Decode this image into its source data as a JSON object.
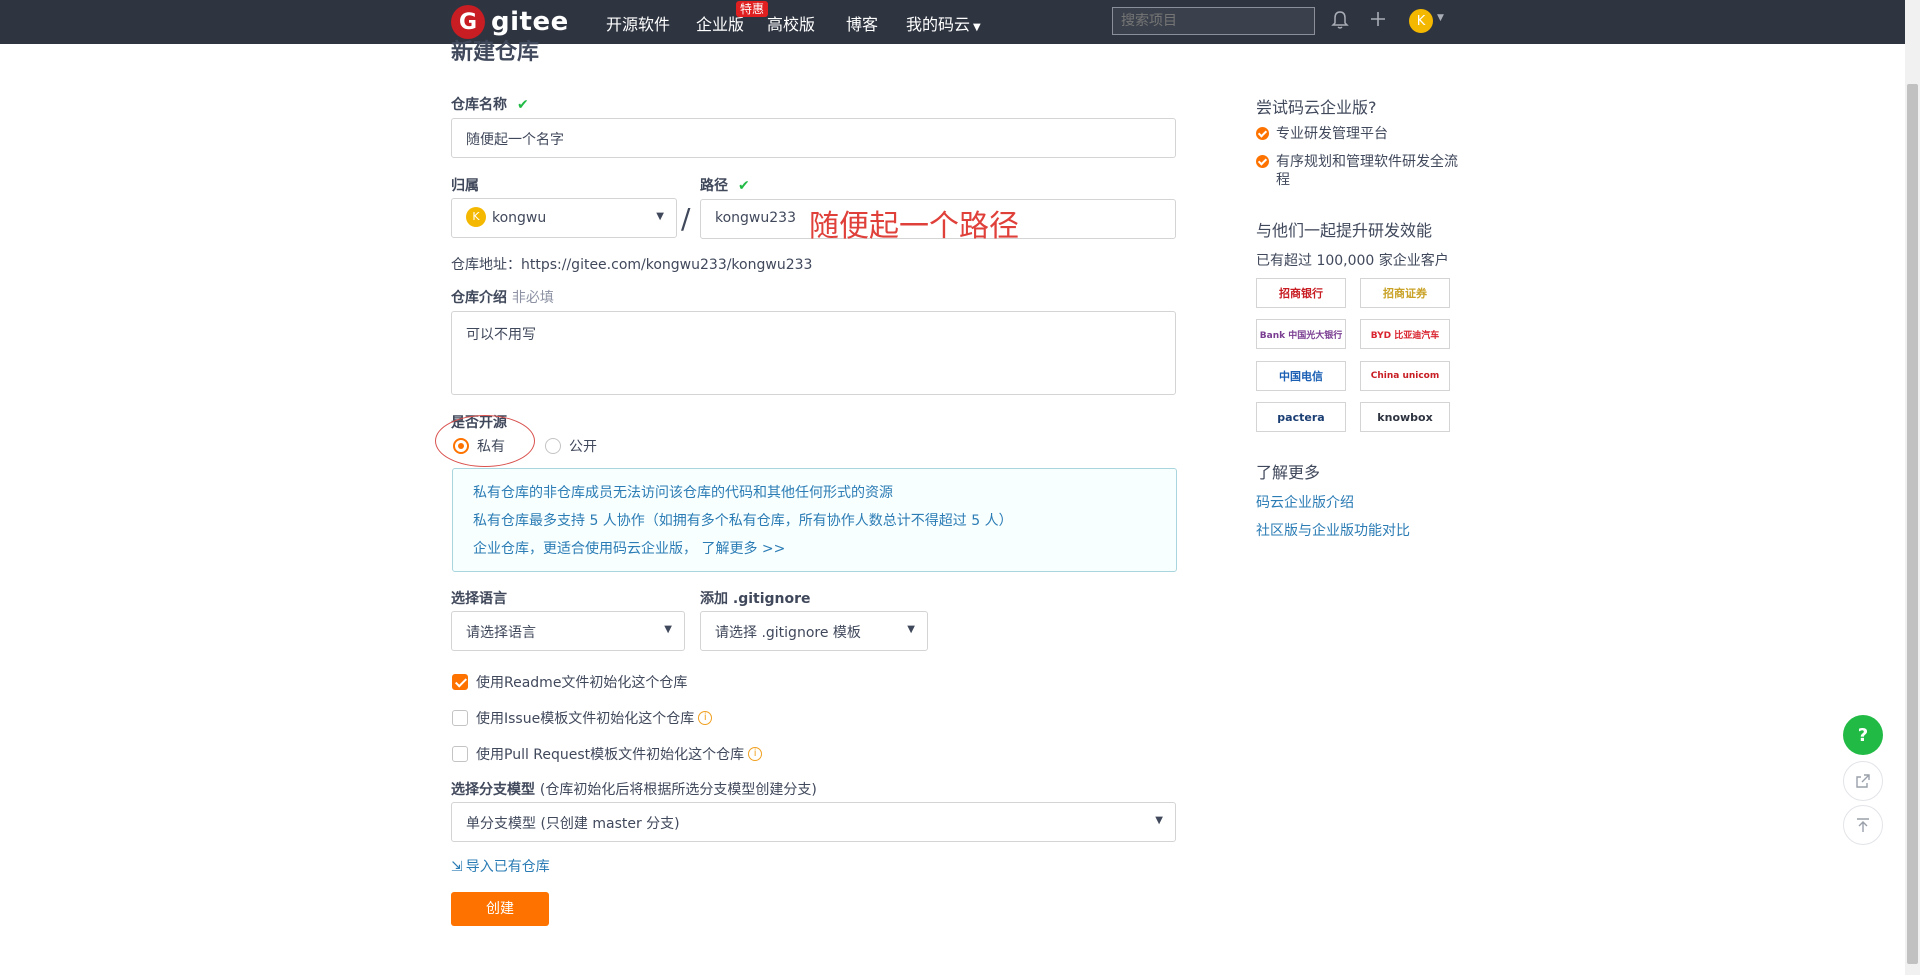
{
  "nav": {
    "logo_text": "gitee",
    "items": [
      "开源软件",
      "企业版",
      "高校版",
      "博客",
      "我的码云"
    ],
    "badge": "特惠",
    "search_placeholder": "搜索项目",
    "avatar_letter": "K",
    "icons": [
      "bell-icon",
      "plus-icon",
      "user-avatar"
    ]
  },
  "form": {
    "title": "新建仓库",
    "repo_name_label": "仓库名称",
    "repo_name_value": "随便起一个名字",
    "owner_label": "归属",
    "owner_value": "kongwu",
    "owner_avatar": "K",
    "path_label": "路径",
    "path_value": "kongwu233",
    "path_annotation": "随便起一个路径",
    "slash": "/",
    "repo_url": "仓库地址：https://gitee.com/kongwu233/kongwu233",
    "desc_label": "仓库介绍",
    "desc_optional": "非必填",
    "desc_value": "可以不用写",
    "open_source_label": "是否开源",
    "radio_private": "私有",
    "radio_public": "公开",
    "info_lines": [
      "私有仓库的非仓库成员无法访问该仓库的代码和其他任何形式的资源",
      "私有仓库最多支持 5 人协作（如拥有多个私有仓库，所有协作人数总计不得超过 5 人）",
      "企业仓库，更适合使用码云企业版， 了解更多 >>"
    ],
    "language_label": "选择语言",
    "language_value": "请选择语言",
    "gitignore_label": "添加 .gitignore",
    "gitignore_value": "请选择 .gitignore 模板",
    "cb_readme": "使用Readme文件初始化这个仓库",
    "cb_issue": "使用Issue模板文件初始化这个仓库",
    "cb_pr": "使用Pull Request模板文件初始化这个仓库",
    "branch_label": "选择分支模型",
    "branch_hint": "(仓库初始化后将根据所选分支模型创建分支)",
    "branch_value": "单分支模型 (只创建 master 分支)",
    "import_link": "导入已有仓库",
    "create_button": "创建"
  },
  "sidebar": {
    "try_heading": "尝试码云企业版?",
    "try_items": [
      "专业研发管理平台",
      "有序规划和管理软件研发全流程"
    ],
    "together_heading": "与他们一起提升研发效能",
    "customers_text": "已有超过 100,000 家企业客户",
    "logos": [
      "招商银行",
      "招商证券",
      "Bank 中国光大银行",
      "BYD 比亚迪汽车",
      "中国电信",
      "China unicom",
      "pactera",
      "knowbox"
    ],
    "learn_heading": "了解更多",
    "links": [
      "码云企业版介绍",
      "社区版与企业版功能对比"
    ]
  },
  "floating": {
    "help": "?",
    "icons": [
      "help-icon",
      "share-icon",
      "back-to-top-icon"
    ]
  },
  "colors": {
    "nav_bg": "#2e3440",
    "accent": "#fe7300",
    "check": "#21ba45",
    "link": "#2b7cb5",
    "annotation": "#e0403a"
  }
}
